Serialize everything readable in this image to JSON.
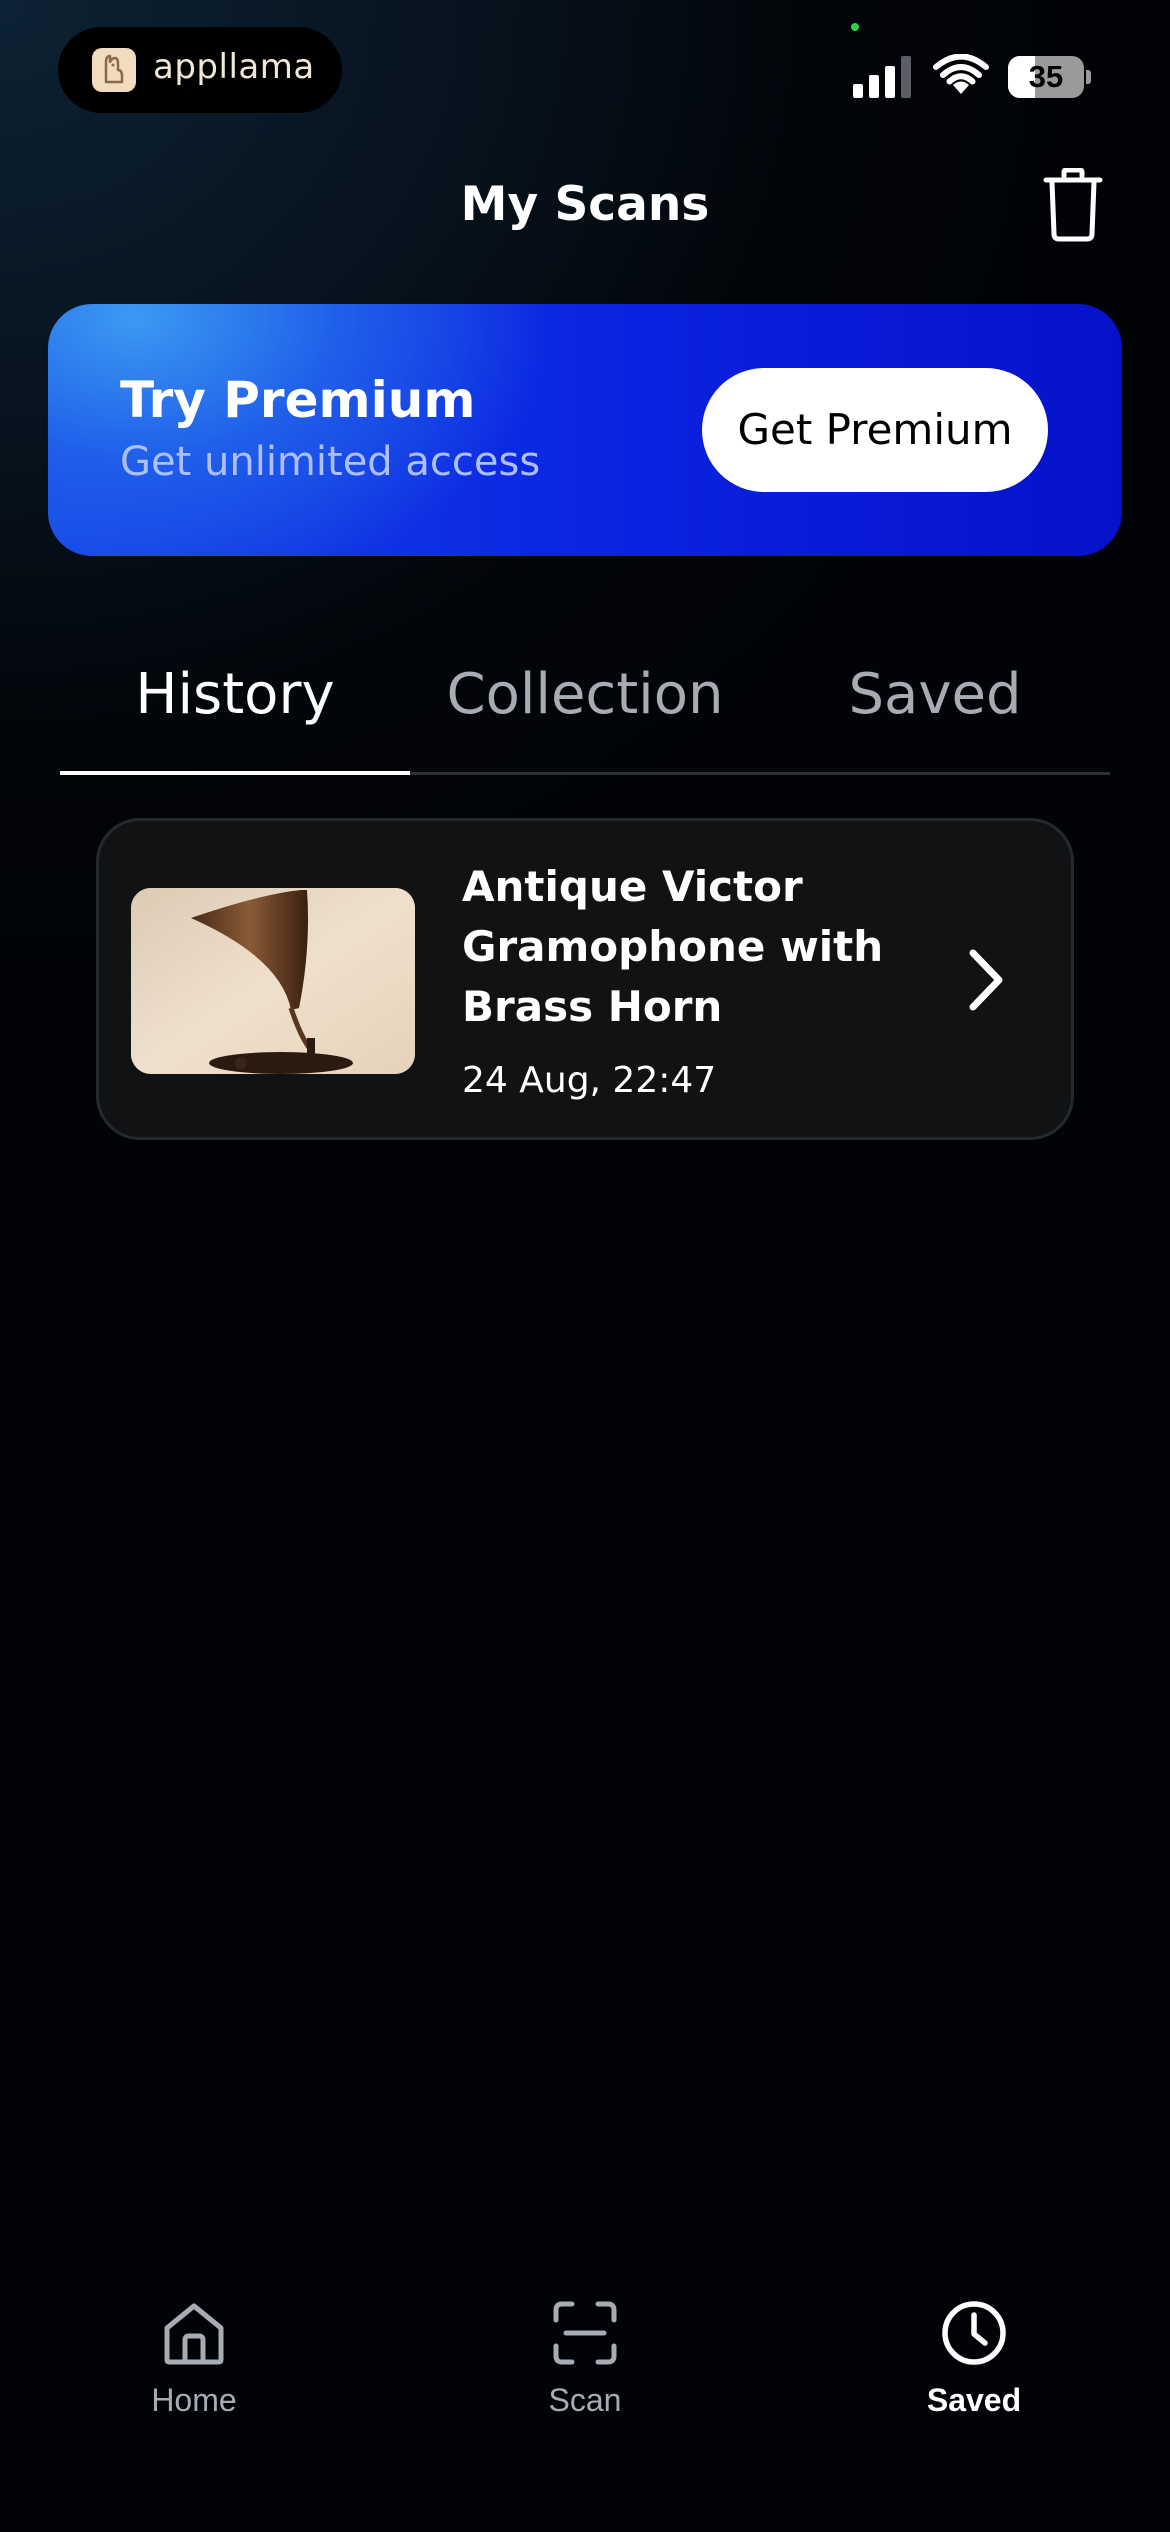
{
  "status_bar": {
    "app_name": "appllama",
    "battery": "35",
    "battery_level": 0.35
  },
  "header": {
    "title": "My Scans",
    "trash_icon": "trash-icon"
  },
  "premium": {
    "title": "Try Premium",
    "subtitle": "Get unlimited access",
    "button_label": "Get Premium"
  },
  "tabs": [
    {
      "label": "History",
      "active": true
    },
    {
      "label": "Collection",
      "active": false
    },
    {
      "label": "Saved",
      "active": false
    }
  ],
  "history": [
    {
      "title": "Antique Victor Gramophone with Brass Horn",
      "date": "24 Aug, 22:47",
      "thumbnail": "gramophone-photo"
    }
  ],
  "bottom_nav": [
    {
      "label": "Home",
      "icon": "home-icon",
      "active": false
    },
    {
      "label": "Scan",
      "icon": "scan-icon",
      "active": false
    },
    {
      "label": "Saved",
      "icon": "clock-icon",
      "active": true
    }
  ],
  "colors": {
    "accent_blue": "#0a22e0",
    "inactive_text": "#a6acb4"
  }
}
